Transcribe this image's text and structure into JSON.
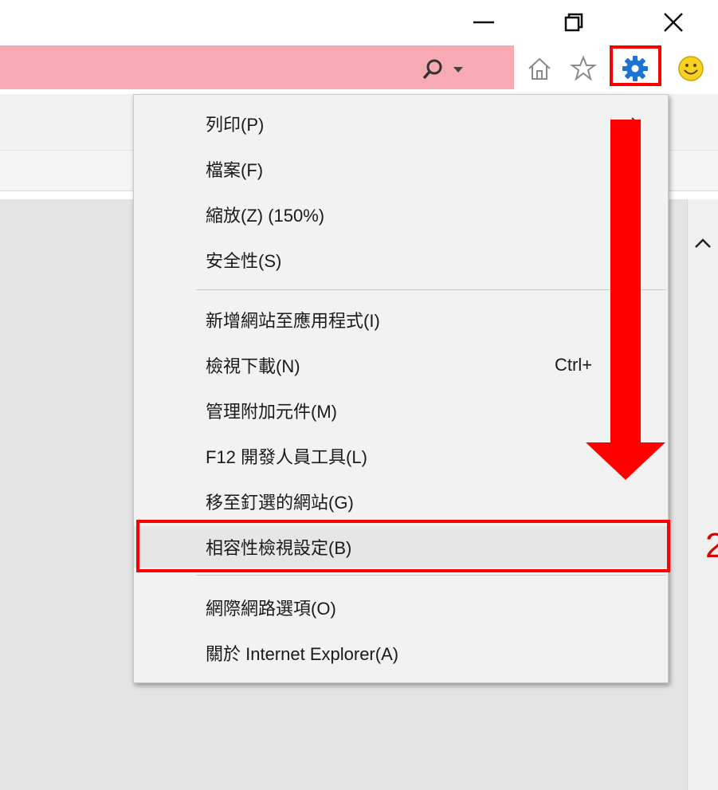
{
  "window": {
    "controls": [
      "minimize-icon",
      "restore-icon",
      "close-icon"
    ]
  },
  "toolbar": {
    "search_icons": [
      "search-icon",
      "dropdown-icon"
    ],
    "nav_icons": [
      "home-icon",
      "star-icon",
      "gear-icon",
      "smiley-icon"
    ],
    "accent": "#f7a9b4"
  },
  "menu": {
    "items": [
      {
        "label": "列印(P)",
        "submenu": true
      },
      {
        "label": "檔案(F)"
      },
      {
        "label": "縮放(Z) (150%)"
      },
      {
        "label": "安全性(S)"
      },
      {
        "label": "新增網站至應用程式(I)"
      },
      {
        "label": "檢視下載(N)",
        "shortcut": "Ctrl+"
      },
      {
        "label": "管理附加元件(M)"
      },
      {
        "label": "F12 開發人員工具(L)"
      },
      {
        "label": "移至釘選的網站(G)"
      },
      {
        "label": "相容性檢視設定(B)"
      },
      {
        "label": "網際網路選項(O)"
      },
      {
        "label": "關於 Internet Explorer(A)"
      }
    ]
  },
  "annotation": {
    "step_label": "2",
    "color": "#ff0000"
  }
}
